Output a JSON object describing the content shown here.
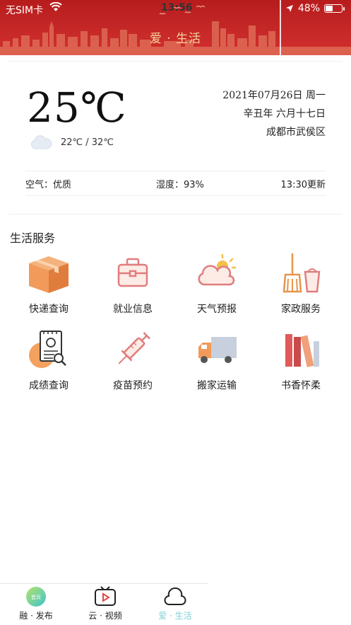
{
  "status_bar": {
    "carrier": "无SIM卡",
    "time": "13:56",
    "battery": "48%",
    "battery_level": 0.48
  },
  "header": {
    "title": "爱 · 生活",
    "colors": {
      "background": "#c62828",
      "title": "#f4d49a"
    }
  },
  "weather": {
    "temperature": "25℃",
    "range": "22℃ / 32℃",
    "date": "2021年07月26日  周一",
    "lunar": "辛丑年 六月十七日",
    "location": "成都市武侯区",
    "air": "空气：优质",
    "humidity": "湿度：93%",
    "updated": "13:30更新",
    "icon": "cloud-icon"
  },
  "services": {
    "title": "生活服务",
    "items": [
      {
        "label": "快递查询",
        "icon": "package-icon"
      },
      {
        "label": "就业信息",
        "icon": "briefcase-icon"
      },
      {
        "label": "天气预报",
        "icon": "weather-icon"
      },
      {
        "label": "家政服务",
        "icon": "broom-bucket-icon"
      },
      {
        "label": "成绩查询",
        "icon": "certificate-search-icon"
      },
      {
        "label": "疫苗预约",
        "icon": "syringe-icon"
      },
      {
        "label": "搬家运输",
        "icon": "truck-icon"
      },
      {
        "label": "书香怀柔",
        "icon": "books-icon"
      }
    ]
  },
  "tabbar": {
    "tabs": [
      {
        "label": "融 · 发布",
        "icon": "home-badge-icon",
        "badge": "首页"
      },
      {
        "label": "云 · 视频",
        "icon": "tv-icon"
      },
      {
        "label": "爱 · 生活",
        "icon": "cloud-outline-icon",
        "active": true
      }
    ],
    "active_color": "#7ed1d8"
  }
}
